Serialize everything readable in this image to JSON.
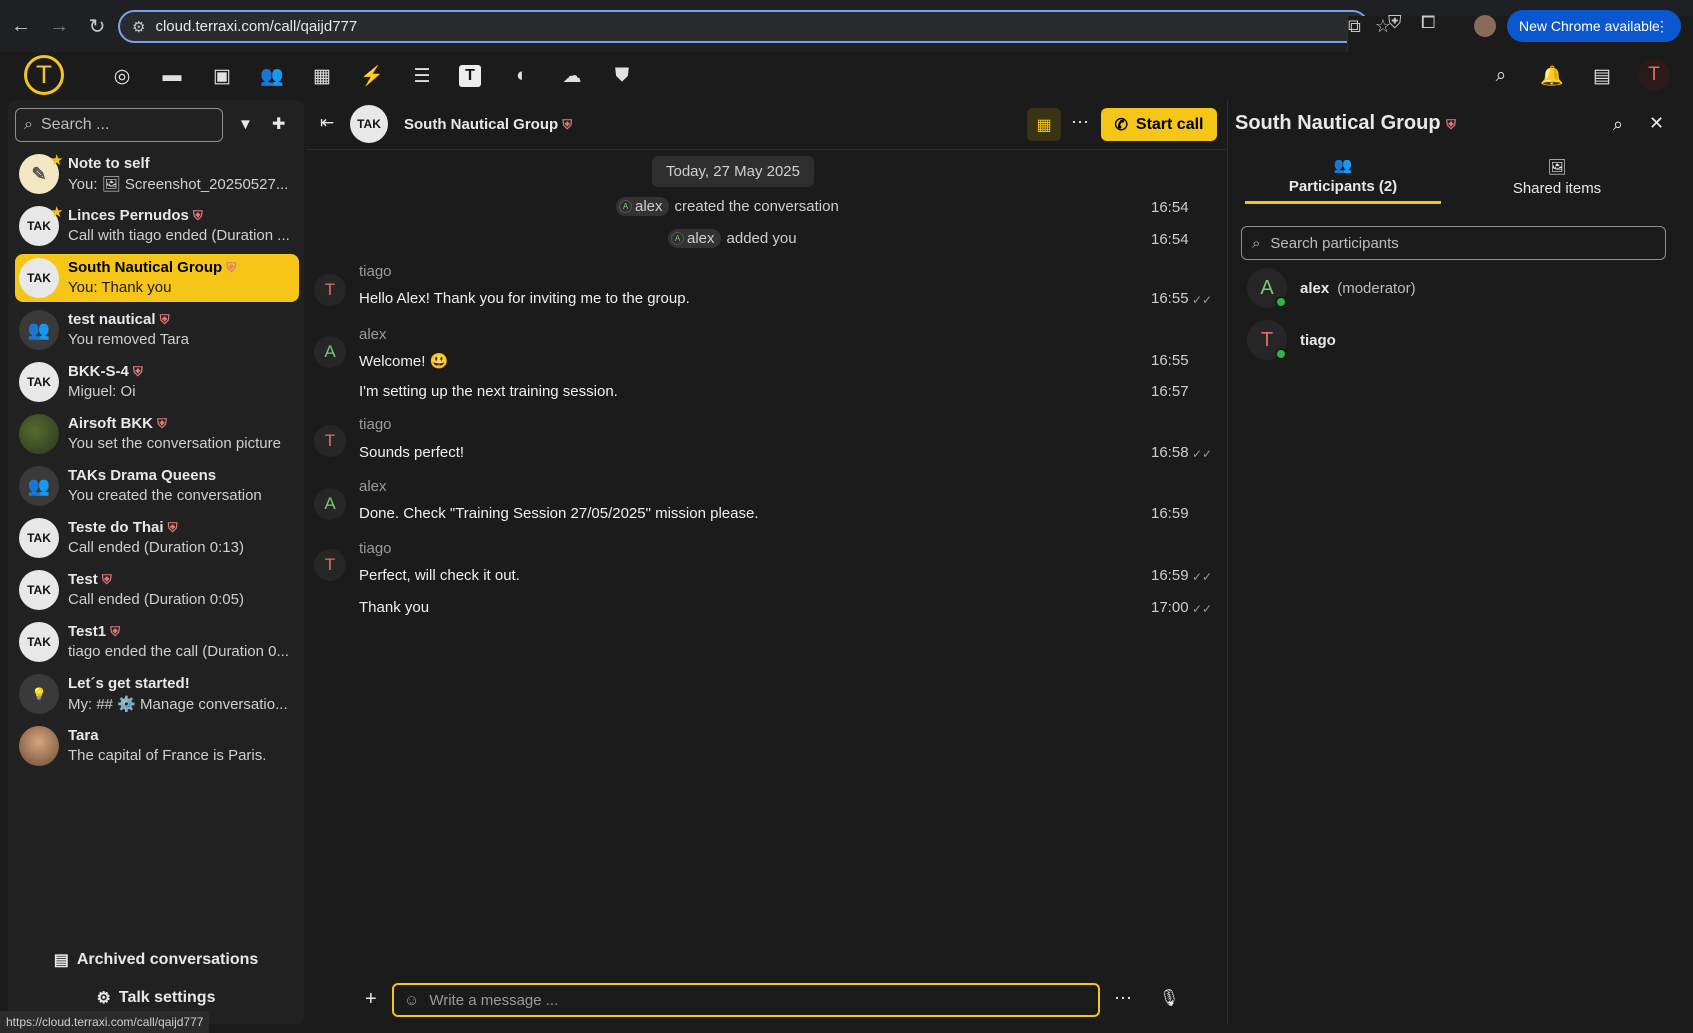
{
  "browser": {
    "url": "cloud.terraxi.com/call/qaijd777",
    "new_chrome_label": "New Chrome available",
    "status_url": "https://cloud.terraxi.com/call/qaijd777"
  },
  "app": {
    "logo_letter": "T",
    "user_initial": "T",
    "accent": "#f5c518"
  },
  "sidebar": {
    "search_placeholder": "Search ...",
    "conversations": [
      {
        "name": "Note to self",
        "preview": "You: 🖼 Screenshot_20250527...",
        "favorite": true
      },
      {
        "name": "Linces Pernudos",
        "preview": "Call with tiago ended (Duration ...",
        "favorite": true
      },
      {
        "name": "South Nautical Group",
        "preview": "You: Thank you",
        "active": true
      },
      {
        "name": "test nautical",
        "preview": "You removed Tara"
      },
      {
        "name": "BKK-S-4",
        "preview": "Miguel: Oi"
      },
      {
        "name": "Airsoft BKK",
        "preview": "You set the conversation picture"
      },
      {
        "name": "TAKs Drama Queens",
        "preview": "You created the conversation"
      },
      {
        "name": "Teste do Thai",
        "preview": "Call ended (Duration 0:13)"
      },
      {
        "name": "Test",
        "preview": "Call ended (Duration 0:05)"
      },
      {
        "name": "Test1",
        "preview": "tiago ended the call (Duration 0..."
      },
      {
        "name": "Let´s get started!",
        "preview": "My: ## ⚙️ Manage conversatio..."
      },
      {
        "name": "Tara",
        "preview": "The capital of France is Paris."
      }
    ],
    "archived_label": "Archived conversations",
    "settings_label": "Talk settings"
  },
  "chat": {
    "title": "South Nautical Group",
    "start_call_label": "Start call",
    "date_separator": "Today, 27 May 2025",
    "system": [
      {
        "user": "alex",
        "text": "created the conversation",
        "time": "16:54"
      },
      {
        "user": "alex",
        "text": "added you",
        "time": "16:54"
      }
    ],
    "messages": [
      {
        "author": "tiago",
        "initial": "T",
        "text": "Hello Alex! Thank you for inviting me to the group.",
        "time": "16:55",
        "read": true
      },
      {
        "author": "alex",
        "initial": "A",
        "text": "Welcome! 😃",
        "time": "16:55"
      },
      {
        "author": "",
        "text": "I'm setting up the next training session.",
        "time": "16:57"
      },
      {
        "author": "tiago",
        "initial": "T",
        "text": "Sounds perfect!",
        "time": "16:58",
        "read": true
      },
      {
        "author": "alex",
        "initial": "A",
        "text": "Done. Check \"Training Session 27/05/2025\" mission please.",
        "time": "16:59"
      },
      {
        "author": "tiago",
        "initial": "T",
        "text": "Perfect, will check it out.",
        "time": "16:59",
        "read": true
      },
      {
        "author": "",
        "text": "Thank you",
        "time": "17:00",
        "read": true
      }
    ],
    "composer_placeholder": "Write a message ..."
  },
  "details": {
    "title": "South Nautical Group",
    "tab_participants": "Participants (2)",
    "tab_shared": "Shared items",
    "search_placeholder": "Search participants",
    "participants": [
      {
        "initial": "A",
        "name": "alex",
        "role": "(moderator)"
      },
      {
        "initial": "T",
        "name": "tiago",
        "role": ""
      }
    ]
  }
}
